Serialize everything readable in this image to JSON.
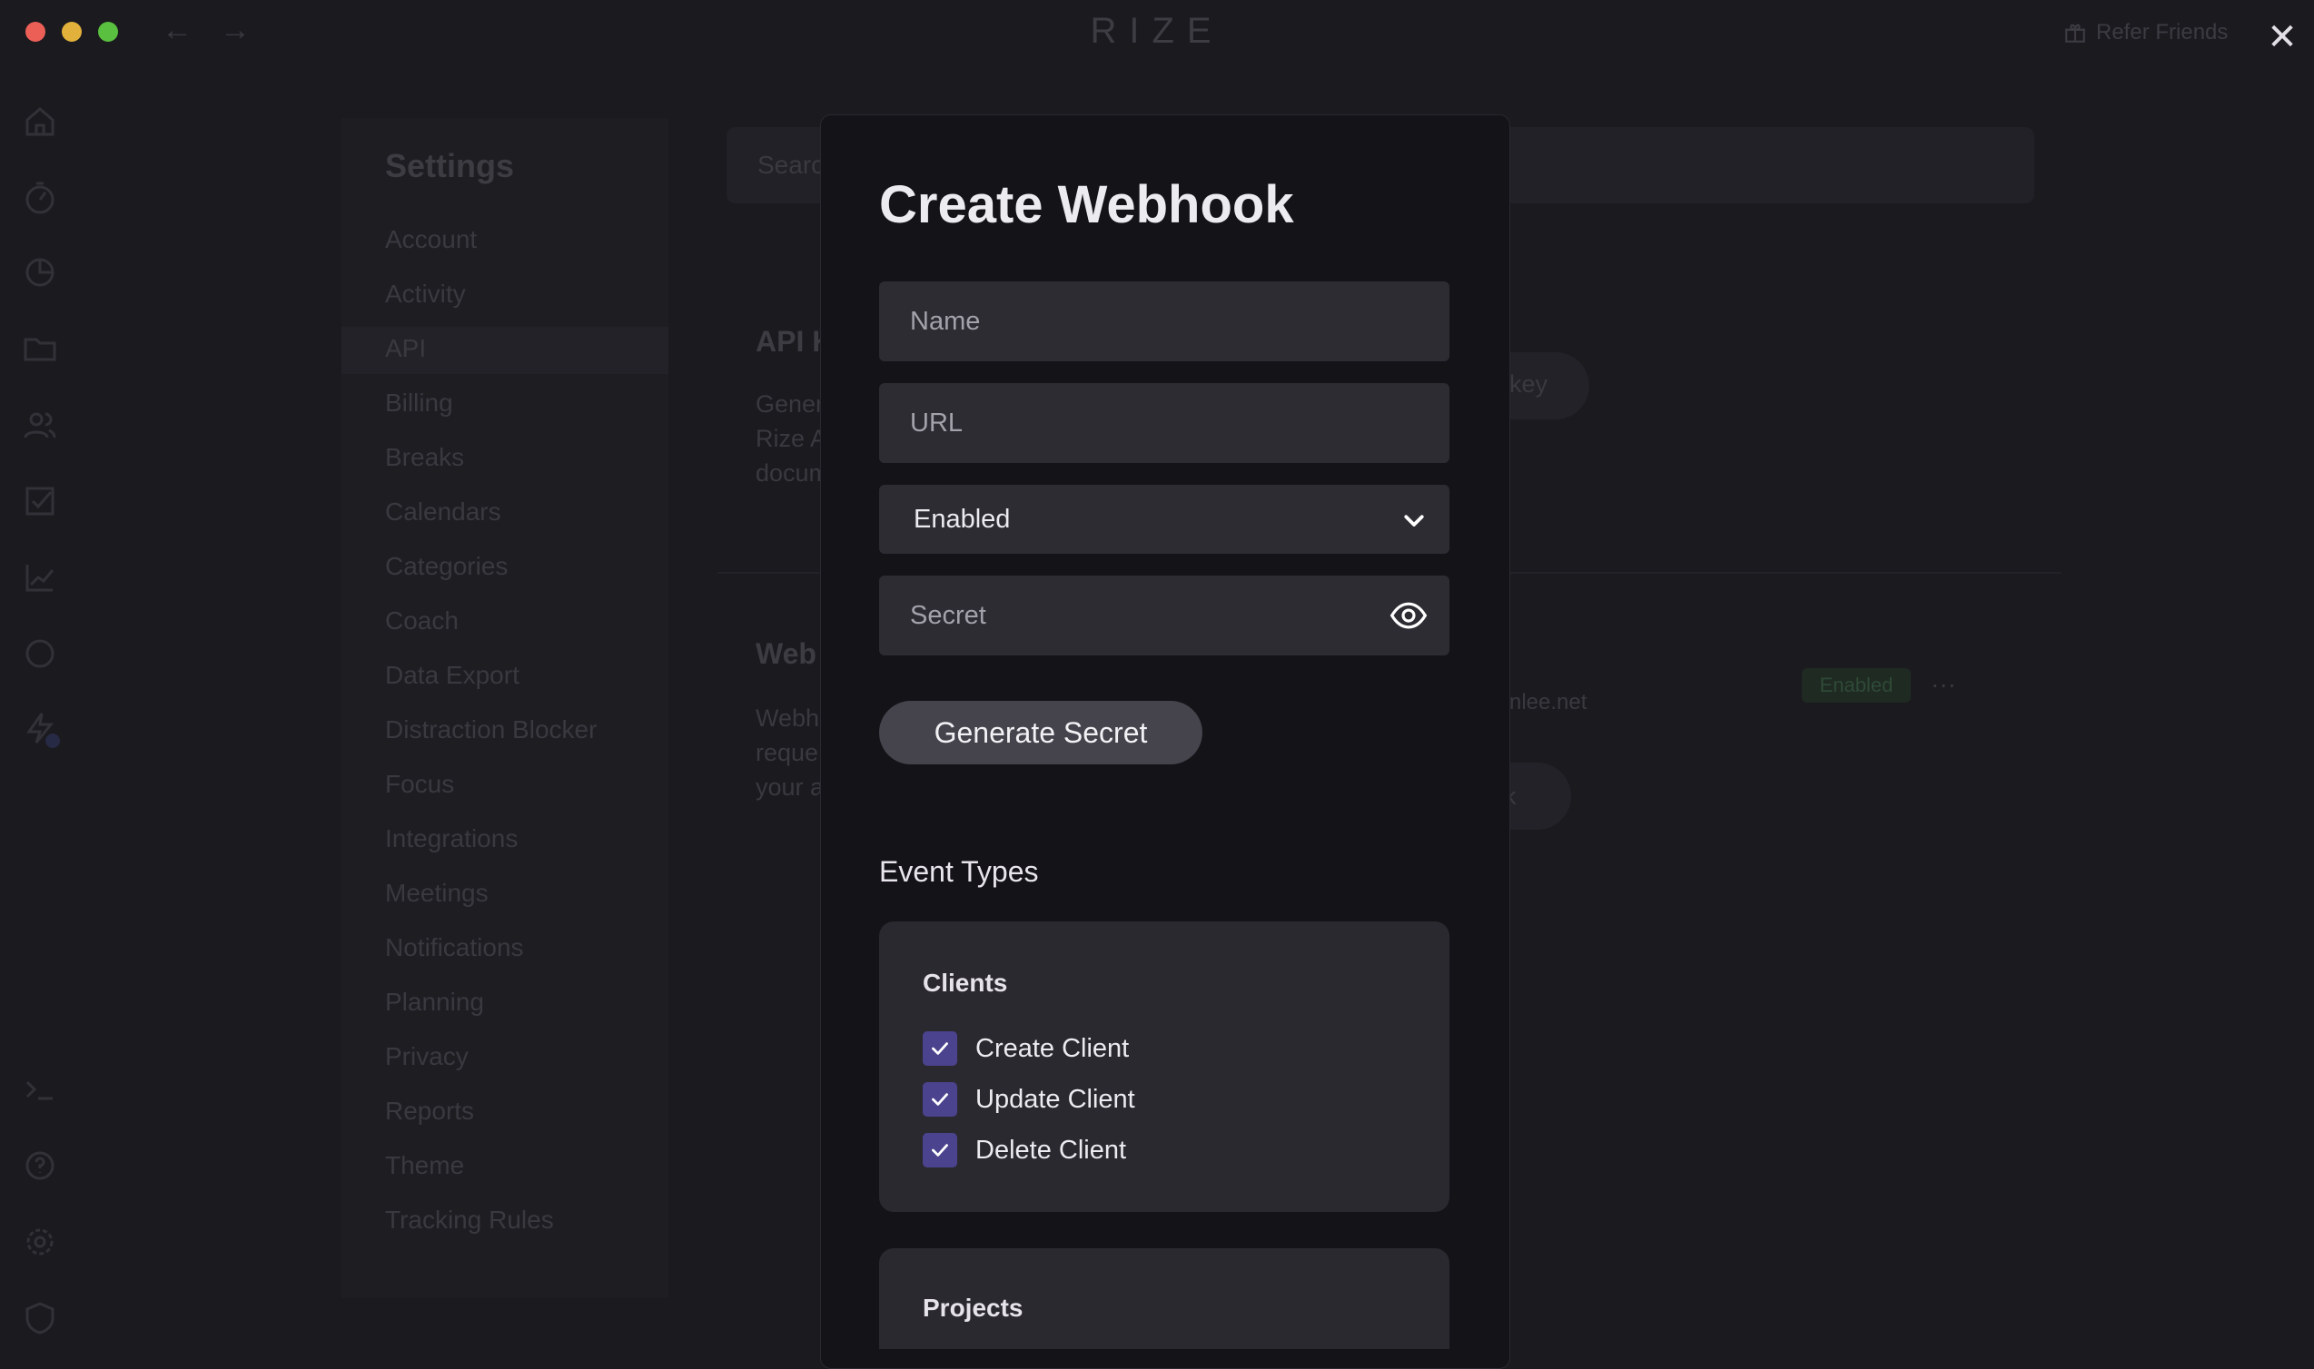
{
  "app": {
    "brand": "RIZE",
    "refer_label": "Refer Friends",
    "close_glyph": "✕",
    "back_glyph": "←",
    "forward_glyph": "→"
  },
  "rail": {
    "icons": [
      "home-icon",
      "timer-icon",
      "pie-chart-icon",
      "folder-icon",
      "users-icon",
      "checklist-icon",
      "trend-chart-icon",
      "target-icon",
      "flash-icon",
      "terminal-icon",
      "help-icon",
      "gear-icon",
      "shield-icon"
    ]
  },
  "settings": {
    "title": "Settings",
    "items": [
      "Account",
      "Activity",
      "API",
      "Billing",
      "Breaks",
      "Calendars",
      "Categories",
      "Coach",
      "Data Export",
      "Distraction Blocker",
      "Focus",
      "Integrations",
      "Meetings",
      "Notifications",
      "Planning",
      "Privacy",
      "Reports",
      "Theme",
      "Tracking Rules"
    ],
    "active": "API"
  },
  "background": {
    "search_placeholder": "Search",
    "api_heading": "API K",
    "api_desc": [
      "Gener",
      "Rize A",
      "docum"
    ],
    "webhooks_heading": "Web",
    "webhooks_desc": [
      "Webh",
      "reque",
      "your a"
    ],
    "pill1": "key",
    "row_url": "nlee.net",
    "row_status": "Enabled",
    "row_more": "···",
    "pill2": "k"
  },
  "modal": {
    "title": "Create Webhook",
    "name_placeholder": "Name",
    "url_placeholder": "URL",
    "status_value": "Enabled",
    "secret_placeholder": "Secret",
    "generate_label": "Generate Secret",
    "event_types_label": "Event Types",
    "groups": [
      {
        "title": "Clients",
        "items": [
          {
            "label": "Create Client",
            "checked": true
          },
          {
            "label": "Update Client",
            "checked": true
          },
          {
            "label": "Delete Client",
            "checked": true
          }
        ]
      },
      {
        "title": "Projects",
        "items": []
      }
    ]
  },
  "colors": {
    "accent": "#4b438e",
    "background": "#1b1a1f",
    "modal": "#141318",
    "field": "#2d2c33"
  }
}
